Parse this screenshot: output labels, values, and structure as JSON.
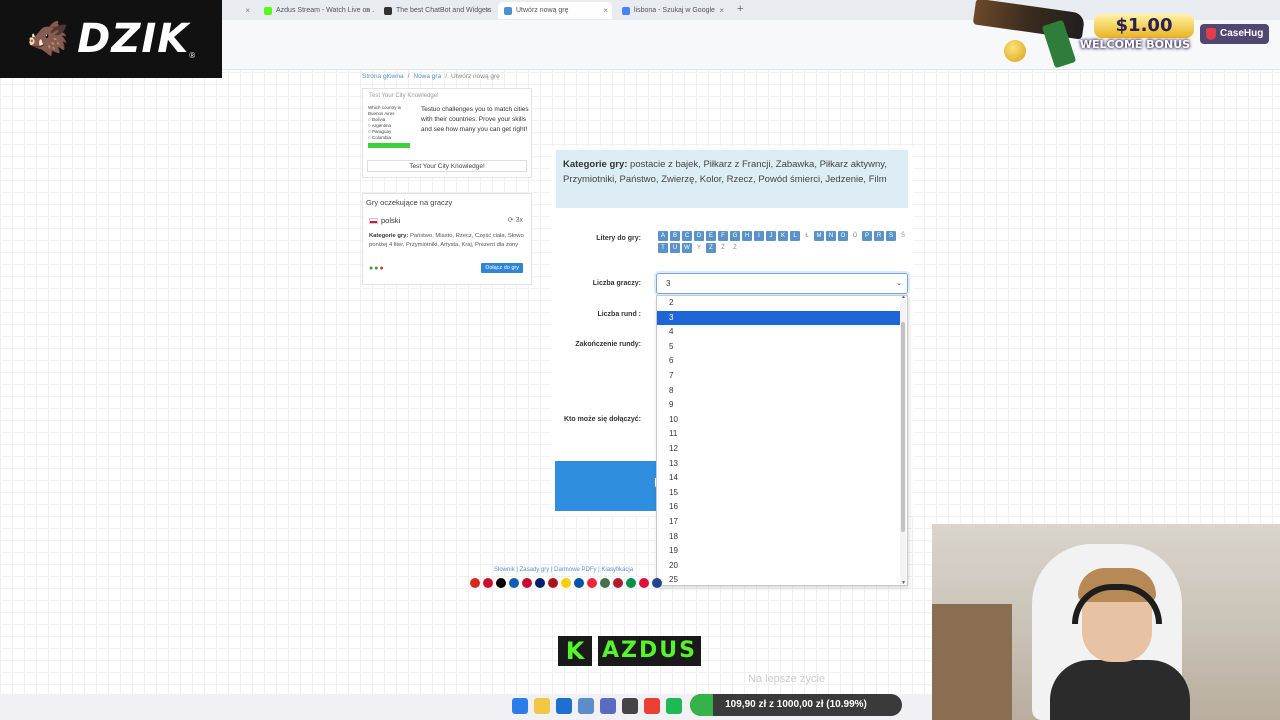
{
  "browser": {
    "tabs": [
      {
        "title": "",
        "active": false,
        "favicon": "#cfcfcf"
      },
      {
        "title": "Azdus Stream - Watch Live on ...",
        "active": false,
        "favicon": "#53fc18"
      },
      {
        "title": "The best ChatBot and Widgets ...",
        "active": false,
        "favicon": "#333333"
      },
      {
        "title": "Utwórz nową grę",
        "active": true,
        "favicon": "#4a8fd8"
      },
      {
        "title": "lisbona - Szukaj w Google",
        "active": false,
        "favicon": "#4285f4"
      }
    ],
    "new_tab_label": "+",
    "close_label": "×"
  },
  "overlay": {
    "logo_icon": "boar-icon",
    "logo_text": "DZIK",
    "logo_reg": "®",
    "promo_amount": "$1.00",
    "promo_text": "WELCOME BONUS",
    "promo_brand": "CaseHug",
    "channel_letter": "K",
    "channel_name": "AZDUS",
    "motto": "Na lepsze życie",
    "goal_text": "109,90 zł z 1000,00 zł (10.99%)",
    "goal_fraction": 0.1099
  },
  "site": {
    "breadcrumb": {
      "home": "Strona główna",
      "sep": "/",
      "new_game": "Nowa gra",
      "current": "Utwórz nową grę"
    },
    "ad": {
      "title": "Test Your City Knowledge!",
      "thumb_question": "Which country is Buenos Aires",
      "thumb_options": [
        "Bolivia",
        "Argentina",
        "Paraguay",
        "Colombia"
      ],
      "description": "Testuo challenges you to match cities with their countries. Prove your skills and see how many you can get right!",
      "link": "Test Your City Knowledge!"
    },
    "waiting": {
      "header": "Gry oczekujące na graczy",
      "language": "polski",
      "count": "3x",
      "categories_label": "Kategorie gry:",
      "categories": "Państwo, Miasto, Rzecz, Część ciała, Słowo poniżej 4 liter, Przymiotniki, Artysta, Kraj, Prezent dla żony",
      "join_button": "Dołącz do gry"
    },
    "form": {
      "categories_label": "Kategorie gry:",
      "categories": "postacie z bajek, Piłkarz z Francji, Zabawka, Piłkarz aktywny, Przymiotniki, Państwo, Zwierzę, Kolor, Rzecz, Powód śmierci, Jedzenie, Film",
      "letters_label": "Litery do gry:",
      "letters": [
        {
          "l": "A",
          "on": true
        },
        {
          "l": "B",
          "on": true
        },
        {
          "l": "C",
          "on": true
        },
        {
          "l": "D",
          "on": true
        },
        {
          "l": "E",
          "on": true
        },
        {
          "l": "F",
          "on": true
        },
        {
          "l": "G",
          "on": true
        },
        {
          "l": "H",
          "on": true
        },
        {
          "l": "I",
          "on": true
        },
        {
          "l": "J",
          "on": true
        },
        {
          "l": "K",
          "on": true
        },
        {
          "l": "L",
          "on": true
        },
        {
          "l": "Ł",
          "on": false
        },
        {
          "l": "M",
          "on": true
        },
        {
          "l": "N",
          "on": true
        },
        {
          "l": "O",
          "on": true
        },
        {
          "l": "Ó",
          "on": false
        },
        {
          "l": "P",
          "on": true
        },
        {
          "l": "R",
          "on": true
        },
        {
          "l": "S",
          "on": true
        },
        {
          "l": "Ś",
          "on": false
        },
        {
          "l": "T",
          "on": true
        },
        {
          "l": "U",
          "on": true
        },
        {
          "l": "W",
          "on": true
        },
        {
          "l": "Y",
          "on": false
        },
        {
          "l": "Z",
          "on": true
        },
        {
          "l": "Ź",
          "on": false
        },
        {
          "l": "Ż",
          "on": false
        }
      ],
      "players_label": "Liczba graczy:",
      "players_value": "3",
      "players_options": [
        "2",
        "3",
        "4",
        "5",
        "6",
        "7",
        "8",
        "9",
        "10",
        "11",
        "12",
        "13",
        "14",
        "15",
        "16",
        "17",
        "18",
        "19",
        "20",
        "25"
      ],
      "players_selected": "3",
      "rounds_label": "Liczba rund :",
      "round_end_label": "Zakończenie rundy:",
      "who_can_join_label": "Kto może się dołączyć:",
      "create_button_partial": "U"
    },
    "footer": {
      "links": "Słownik | Zasady gry | Darmowe PDFy | Klasyfikacja"
    }
  },
  "colors": {
    "accent": "#2f8ee0",
    "selected_option": "#1e66d6",
    "category_box": "#dcedf6",
    "kick_green": "#55f52c"
  }
}
